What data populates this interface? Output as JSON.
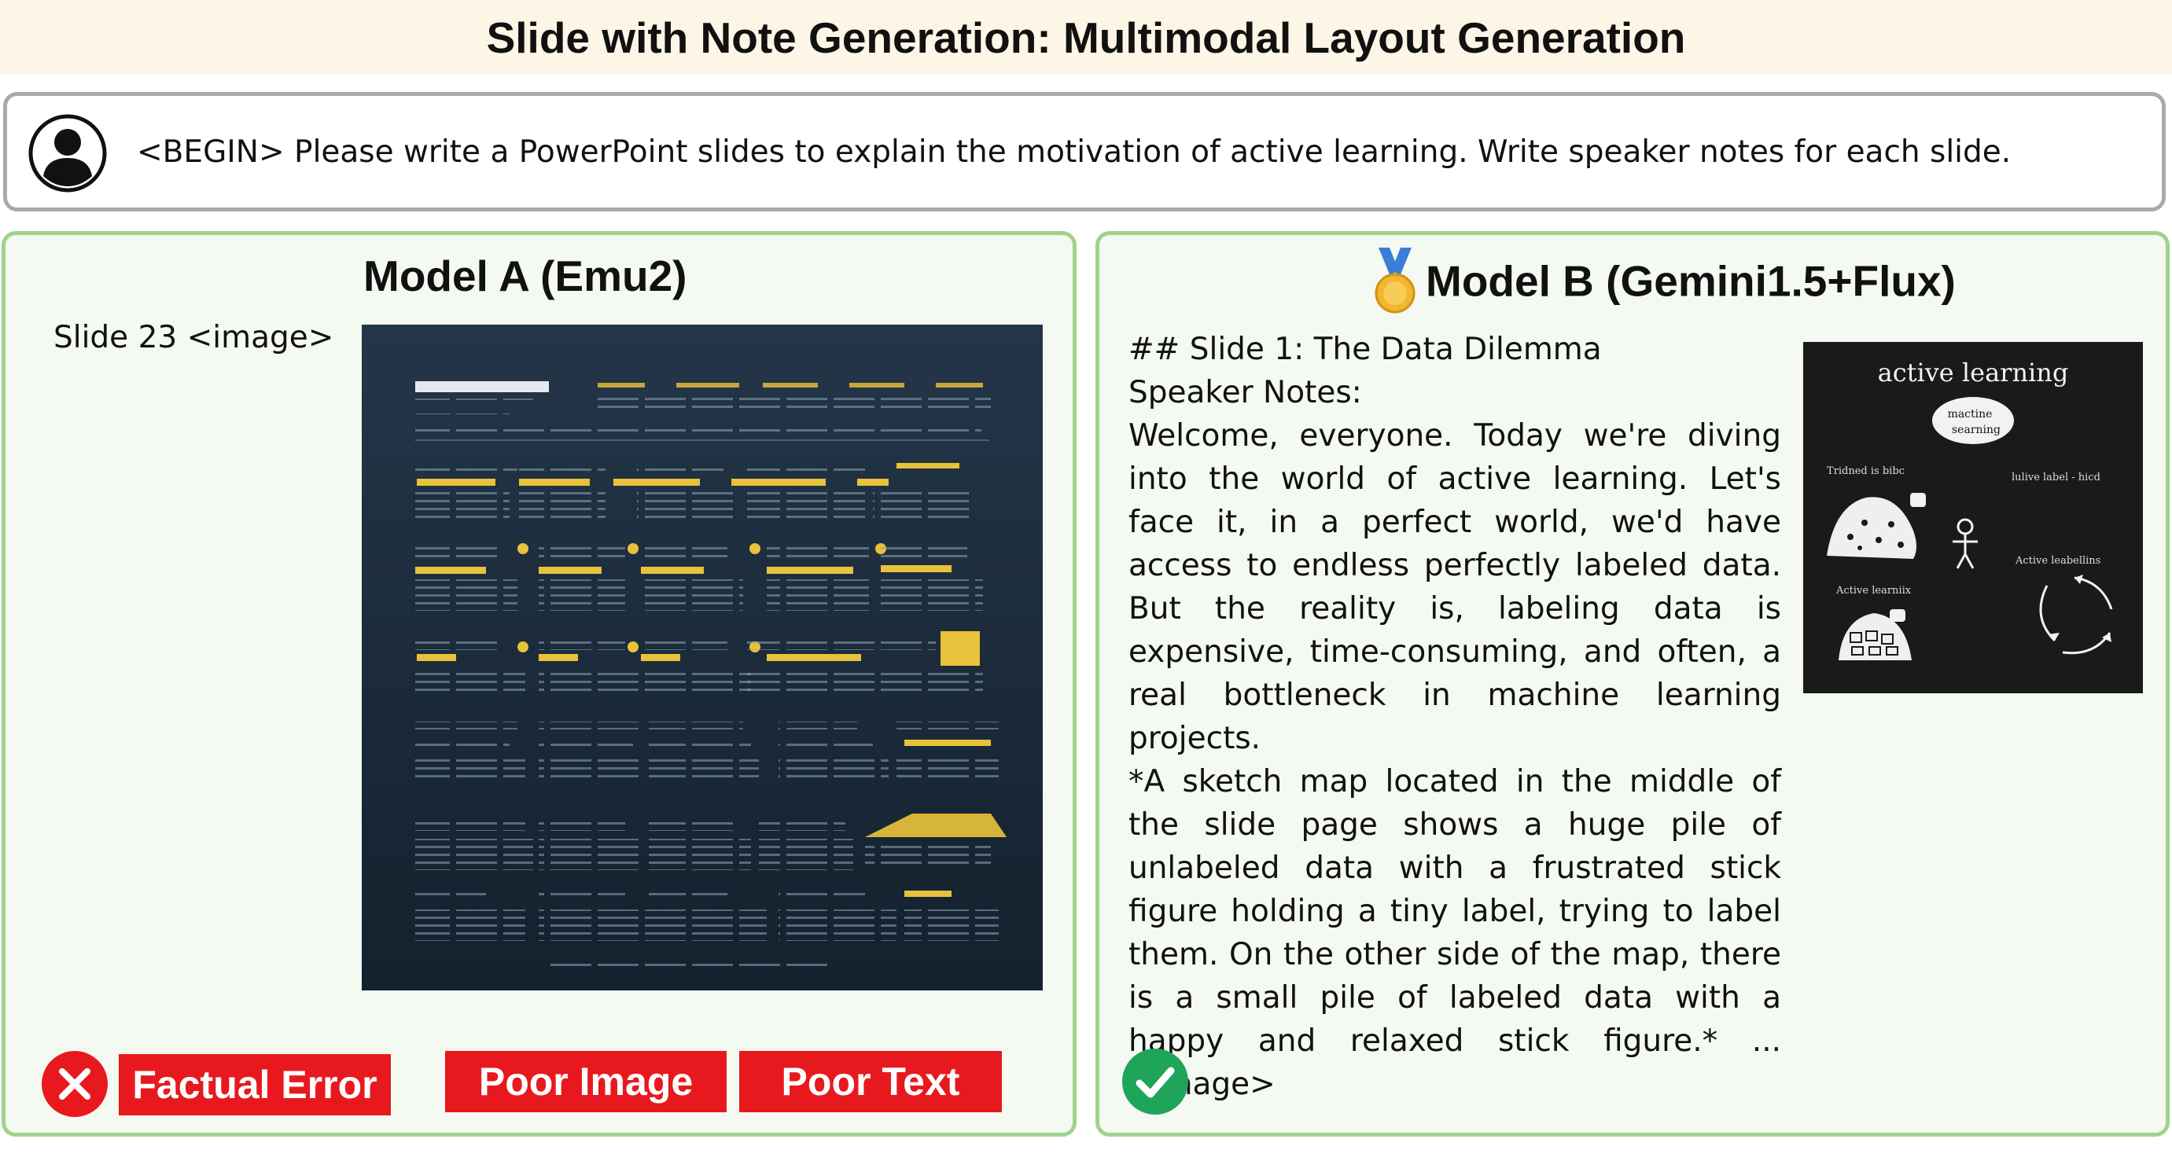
{
  "title": "Slide with Note Generation: Multimodal Layout Generation",
  "prompt": {
    "icon": "user-avatar-icon",
    "text": "<BEGIN> Please write a PowerPoint slides to explain the motivation of active learning. Write speaker notes for each slide."
  },
  "model_a": {
    "title": "Model A (Emu2)",
    "slide_label": "Slide 23 <image>",
    "result_icon": "x-circle-icon",
    "tags": [
      "Factual Error",
      "Poor Image",
      "Poor Text"
    ]
  },
  "model_b": {
    "medal_icon": "gold-medal-icon",
    "title": "Model B (Gemini1.5+Flux)",
    "heading": "## Slide 1: The Data Dilemma",
    "notes_label": "Speaker Notes:",
    "notes_body": "Welcome, everyone. Today we're diving into the world of active learning. Let's face it, in a perfect world, we'd have access to endless perfectly labeled data. But the reality is, labeling data is expensive, time-consuming, and often, a real bottleneck in machine learning projects.",
    "image_description": "*A sketch map located in the middle of the slide page shows a huge pile of unlabeled data with a frustrated stick figure holding a tiny label, trying to label them. On the other side of the map, there is a small pile of labeled data with a happy and relaxed stick figure.*  ... <image>",
    "sketch": {
      "title": "active learning",
      "bubble_line1": "mactine",
      "bubble_line2": "searning",
      "label_left": "Tridned is bibc",
      "label_right": "lulive label - hicd",
      "label_lower_left": "Active learniix",
      "label_lower_right": "Active leabellins"
    },
    "result_icon": "check-circle-icon"
  },
  "colors": {
    "title_bg": "#fdf6e6",
    "panel_border": "#9ed489",
    "panel_bg": "#f4f9f1",
    "tag_red": "#e8191e",
    "check_green": "#1ea55a"
  }
}
